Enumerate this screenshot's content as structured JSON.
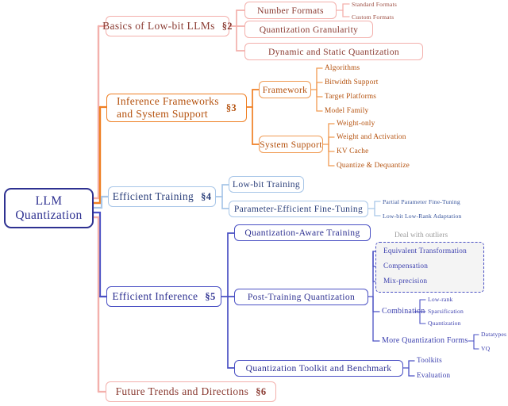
{
  "diagram": {
    "type": "mindmap",
    "root": {
      "line1": "LLM",
      "line2": "Quantization"
    },
    "colors": {
      "root": "#2e3191",
      "basics": "#f3b0ac",
      "inference_frameworks": "#ef7f23",
      "efficient_training": "#a8c6e8",
      "efficient_inference": "#4a50c4",
      "future_trends": "#f3b0ac",
      "outlier_group_border": "#4a50c4",
      "outlier_group_fill": "#f4f4f4",
      "outlier_group_label": "#9d9d9d"
    },
    "branches": [
      {
        "id": "basics",
        "label": "Basics of Low-bit LLMs",
        "section": "§2",
        "children": [
          {
            "label": "Number Formats",
            "children": [
              {
                "label": "Standard Formats"
              },
              {
                "label": "Custom Formats"
              }
            ]
          },
          {
            "label": "Quantization Granularity",
            "children": []
          },
          {
            "label": "Dynamic and Static Quantization",
            "children": []
          }
        ]
      },
      {
        "id": "inference-frameworks",
        "label_line1": "Inference Frameworks",
        "label_line2": "and System Support",
        "section": "§3",
        "children": [
          {
            "label": "Framework",
            "children": [
              {
                "label": "Algorithms"
              },
              {
                "label": "Bitwidth Support"
              },
              {
                "label": "Target Platforms"
              },
              {
                "label": "Model Family"
              }
            ]
          },
          {
            "label": "System Support",
            "children": [
              {
                "label": "Weight-only"
              },
              {
                "label": "Weight and Activation"
              },
              {
                "label": "KV Cache"
              },
              {
                "label": "Quantize & Dequantize"
              }
            ]
          }
        ]
      },
      {
        "id": "efficient-training",
        "label": "Efficient Training",
        "section": "§4",
        "children": [
          {
            "label": "Low-bit Training",
            "children": []
          },
          {
            "label": "Parameter-Efficient Fine-Tuning",
            "children": [
              {
                "label": "Partial Parameter Fine-Tuning"
              },
              {
                "label": "Low-bit Low-Rank Adaptation"
              }
            ]
          }
        ]
      },
      {
        "id": "efficient-inference",
        "label": "Efficient Inference",
        "section": "§5",
        "children": [
          {
            "label": "Quantization-Aware Training",
            "children": []
          },
          {
            "label": "Post-Training Quantization",
            "group_label": "Deal with outliers",
            "grouped_children": [
              {
                "label": "Equivalent Transformation"
              },
              {
                "label": "Compensation"
              },
              {
                "label": "Mix-precision"
              }
            ],
            "children": [
              {
                "label": "Combination",
                "children": [
                  {
                    "label": "Low-rank"
                  },
                  {
                    "label": "Sparsification"
                  },
                  {
                    "label": "Quantization"
                  }
                ]
              },
              {
                "label": "More Quantization Forms",
                "children": [
                  {
                    "label": "Datatypes"
                  },
                  {
                    "label": "VQ"
                  }
                ]
              }
            ]
          },
          {
            "label": "Quantization Toolkit and Benchmark",
            "children": [
              {
                "label": "Toolkits"
              },
              {
                "label": "Evaluation"
              }
            ]
          }
        ]
      },
      {
        "id": "future-trends",
        "label": "Future Trends and Directions",
        "section": "§6",
        "children": []
      }
    ]
  }
}
